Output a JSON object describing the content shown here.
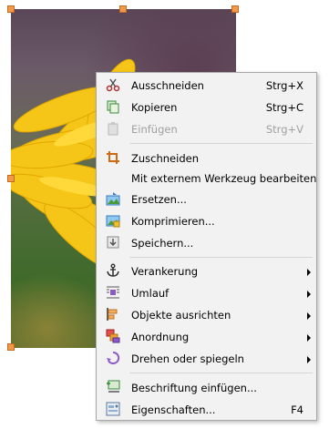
{
  "menu": {
    "cut": {
      "label": "Ausschneiden",
      "shortcut": "Strg+X",
      "icon": "scissors-icon"
    },
    "copy": {
      "label": "Kopieren",
      "shortcut": "Strg+C",
      "icon": "copy-icon"
    },
    "paste": {
      "label": "Einfügen",
      "shortcut": "Strg+V",
      "icon": "paste-icon",
      "disabled": true
    },
    "crop": {
      "label": "Zuschneiden",
      "icon": "crop-icon"
    },
    "edit_external": {
      "label": "Mit externem Werkzeug bearbeiten"
    },
    "replace": {
      "label": "Ersetzen...",
      "icon": "replace-image-icon"
    },
    "compress": {
      "label": "Komprimieren...",
      "icon": "compress-icon"
    },
    "save": {
      "label": "Speichern...",
      "icon": "save-icon"
    },
    "anchor": {
      "label": "Verankerung",
      "icon": "anchor-icon"
    },
    "wrap": {
      "label": "Umlauf",
      "icon": "text-wrap-icon"
    },
    "align": {
      "label": "Objekte ausrichten",
      "icon": "align-objects-icon"
    },
    "arrange": {
      "label": "Anordnung",
      "icon": "arrange-icon"
    },
    "rotate": {
      "label": "Drehen oder spiegeln",
      "icon": "rotate-icon"
    },
    "caption": {
      "label": "Beschriftung einfügen...",
      "icon": "insert-caption-icon"
    },
    "properties": {
      "label": "Eigenschaften...",
      "shortcut": "F4",
      "icon": "properties-icon"
    }
  }
}
